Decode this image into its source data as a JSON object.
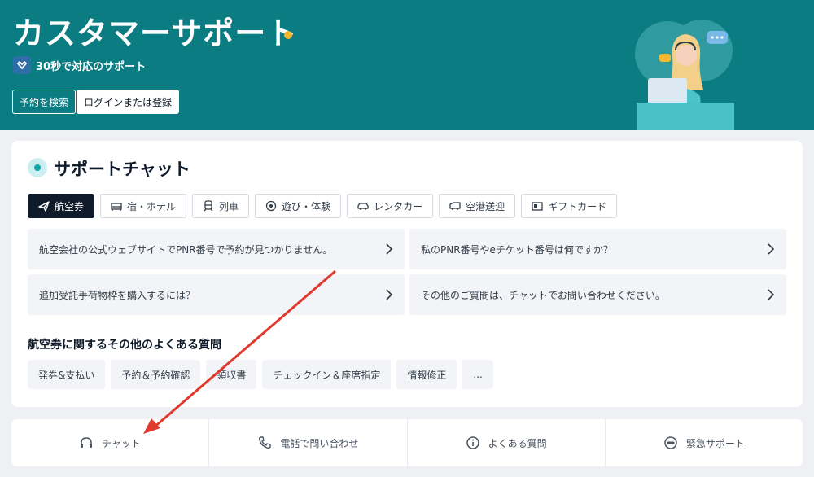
{
  "hero": {
    "title": "カスタマーサポート",
    "badge": "30秒で対応のサポート",
    "search_button": "予約を検索",
    "login_button": "ログインまたは登録"
  },
  "chat_section": {
    "title": "サポートチャット",
    "tabs": [
      {
        "label": "航空券",
        "icon": "plane-icon",
        "active": true
      },
      {
        "label": "宿・ホテル",
        "icon": "bed-icon",
        "active": false
      },
      {
        "label": "列車",
        "icon": "train-icon",
        "active": false
      },
      {
        "label": "遊び・体験",
        "icon": "ticket-icon",
        "active": false
      },
      {
        "label": "レンタカー",
        "icon": "car-icon",
        "active": false
      },
      {
        "label": "空港送迎",
        "icon": "shuttle-icon",
        "active": false
      },
      {
        "label": "ギフトカード",
        "icon": "gift-card-icon",
        "active": false
      }
    ],
    "faqs": [
      "航空会社の公式ウェブサイトでPNR番号で予約が見つかりません。",
      "私のPNR番号やeチケット番号は何ですか？",
      "追加受託手荷物枠を購入するには？",
      "その他のご質問は、チャットでお問い合わせください。"
    ],
    "more_title": "航空券に関するその他のよくある質問",
    "chips": [
      "発券&支払い",
      "予約＆予約確認",
      "領収書",
      "チェックイン＆座席指定",
      "情報修正",
      "..."
    ]
  },
  "bottom_bar": [
    {
      "label": "チャット",
      "icon": "headset-icon"
    },
    {
      "label": "電話で問い合わせ",
      "icon": "phone-icon"
    },
    {
      "label": "よくある質問",
      "icon": "info-icon"
    },
    {
      "label": "緊急サポート",
      "icon": "sos-icon"
    }
  ],
  "colors": {
    "hero_bg": "#0a7c82",
    "accent_dot": "#f5b82e",
    "active_tab": "#0f1a2a",
    "annotation_arrow": "#e03a2e"
  }
}
